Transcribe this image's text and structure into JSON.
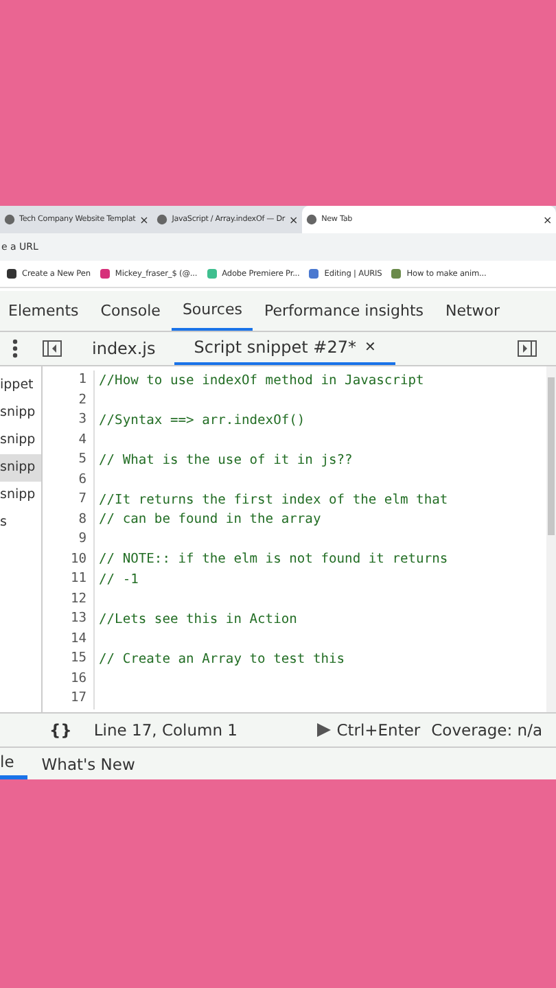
{
  "browser_tabs": [
    {
      "title": "Tech Company Website Templat",
      "close": "×",
      "selected": false
    },
    {
      "title": "JavaScript / Array.indexOf — Dr",
      "close": "×",
      "selected": false
    },
    {
      "title": "New Tab",
      "close": "×",
      "selected": true
    }
  ],
  "address_bar": {
    "placeholder": "e a URL"
  },
  "bookmarks": [
    {
      "label": "Create a New Pen",
      "color": "#333333"
    },
    {
      "label": "Mickey_fraser_$ (@...",
      "color": "#d6307a"
    },
    {
      "label": "Adobe Premiere Pr...",
      "color": "#3fbf8f"
    },
    {
      "label": "Editing | AURIS",
      "color": "#4a78d0"
    },
    {
      "label": "How to make anim...",
      "color": "#6a8a4a"
    }
  ],
  "devtools_tabs": [
    {
      "label": "Elements",
      "selected": false
    },
    {
      "label": "Console",
      "selected": false
    },
    {
      "label": "Sources",
      "selected": true
    },
    {
      "label": "Performance insights",
      "selected": false
    },
    {
      "label": "Networ",
      "selected": false
    }
  ],
  "file_tabs": [
    {
      "label": "index.js",
      "selected": false
    },
    {
      "label": "Script snippet #27*",
      "close": "✕",
      "selected": true
    }
  ],
  "sidebar_items": [
    {
      "label": "ippet",
      "selected": false
    },
    {
      "label": "snipp",
      "selected": false
    },
    {
      "label": "snipp",
      "selected": false
    },
    {
      "label": "snipp",
      "selected": true
    },
    {
      "label": "snipp",
      "selected": false
    },
    {
      "label": "s",
      "selected": false
    }
  ],
  "code_lines": [
    {
      "number": "1",
      "text": "//How to use indexOf method in Javascript"
    },
    {
      "number": "2"
    },
    {
      "number": "3",
      "text": "//Syntax ==> arr.indexOf()"
    },
    {
      "number": "4"
    },
    {
      "number": "5",
      "text": "// What is the use of it in js??"
    },
    {
      "number": "6"
    },
    {
      "number": "7",
      "text": "//It returns the first index of the elm that"
    },
    {
      "number": "8",
      "text": "// can be found in the array"
    },
    {
      "number": "9"
    },
    {
      "number": "10",
      "text": "// NOTE:: if the elm is not found it returns"
    },
    {
      "number": "11",
      "text": "// -1"
    },
    {
      "number": "12"
    },
    {
      "number": "13",
      "text": "//Lets see this in Action"
    },
    {
      "number": "14"
    },
    {
      "number": "15",
      "text": "// Create an Array to test this"
    },
    {
      "number": "16"
    },
    {
      "number": "17"
    }
  ],
  "status_bar": {
    "format_icon": "{}",
    "position": "Line 17, Column 1",
    "run": "Ctrl+Enter",
    "coverage": "Coverage: n/a"
  },
  "drawer_tabs": [
    {
      "label": "le",
      "selected": true
    },
    {
      "label": "What's New",
      "selected": false
    }
  ]
}
